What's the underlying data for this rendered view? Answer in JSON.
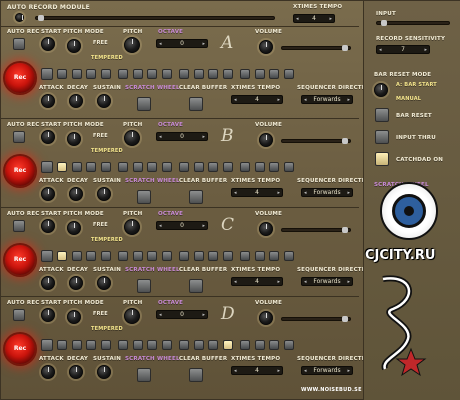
{
  "header": {
    "module_label": "Auto Record module",
    "xtimes_label": "xTimes Tempo",
    "xtimes_value": "4"
  },
  "sidebar": {
    "input_label": "Input",
    "rec_sensitivity_label": "Record Sensitivity",
    "rec_sensitivity_value": "7",
    "bar_reset_mode_label": "Bar Reset Mode",
    "bar_reset_option_1": "A: Bar Start",
    "bar_reset_option_2": "Manual",
    "bar_reset_label": "Bar Reset",
    "input_thru_label": "Input Thru",
    "catchdad_label": "CatchDad On",
    "scratch_label": "Scratch Wheel",
    "watermark": "CJCITY.RU"
  },
  "credit": "WWW.NOISEBUD.SE",
  "channels": [
    {
      "letter": "A",
      "octave": "0",
      "xtimes": "4",
      "direction": "Forwards"
    },
    {
      "letter": "B",
      "octave": "0",
      "xtimes": "4",
      "direction": "Forwards"
    },
    {
      "letter": "C",
      "octave": "0",
      "xtimes": "4",
      "direction": "Forwards"
    },
    {
      "letter": "D",
      "octave": "0",
      "xtimes": "4",
      "direction": "Forwards"
    }
  ],
  "labels": {
    "auto_rec": "Auto Rec",
    "start": "Start",
    "pitch_mode": "Pitch Mode",
    "free": "Free",
    "tempered": "Tempered",
    "pitch": "Pitch",
    "octave": "Octave",
    "volume": "Volume",
    "rec": "Rec",
    "attack": "Attack",
    "decay": "Decay",
    "sustain": "Sustain",
    "scratch_wheel": "Scratch Wheel",
    "clear_buffer": "Clear Buffer",
    "xtimes_tempo": "xTimes Tempo",
    "seq_direction": "Sequencer Direction"
  },
  "colors": {
    "accent_purple": "#c98ad6",
    "rec_red": "#c9140c",
    "panel": "#6e6146",
    "lit_step": "#fff0b8"
  }
}
